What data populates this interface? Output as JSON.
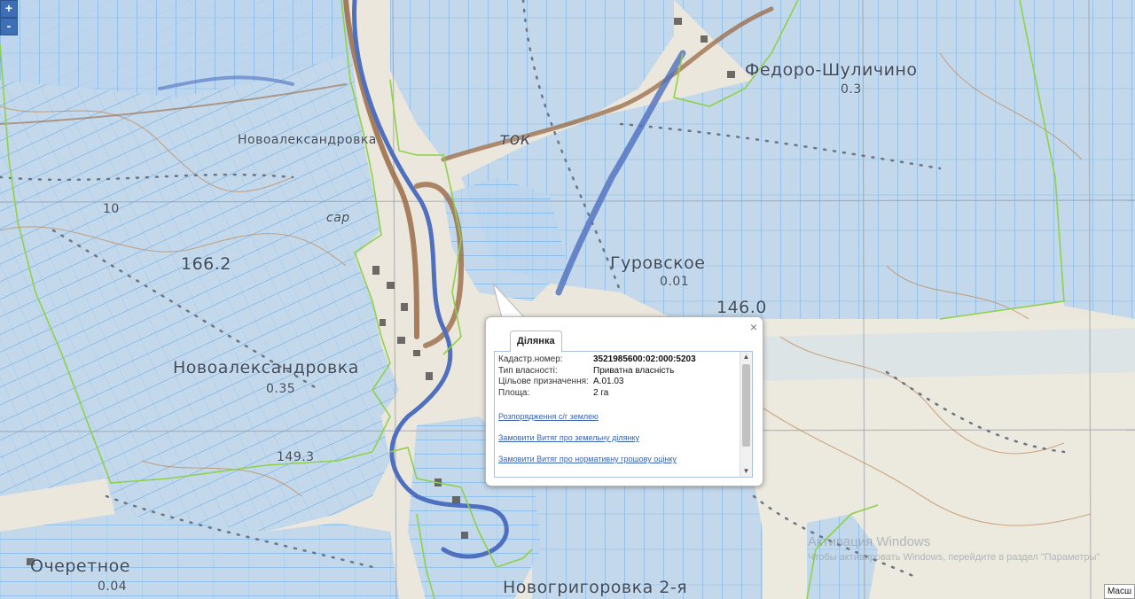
{
  "map": {
    "place_labels": [
      {
        "id": "fedoro-shulichino",
        "text": "Федоро-Шуличино"
      },
      {
        "id": "novaleksandrovka-top",
        "text": "Новоалександровка"
      },
      {
        "id": "novaleksandrovka-main",
        "text": "Новоалександровка"
      },
      {
        "id": "gurovskoe",
        "text": "Гуровское"
      },
      {
        "id": "ocheretnoe",
        "text": "Очеретное"
      },
      {
        "id": "novogrigorovka",
        "text": "Новогригоровка 2-я"
      },
      {
        "id": "tok",
        "text": "ток"
      },
      {
        "id": "sar",
        "text": "сар"
      },
      {
        "id": "elev-166",
        "text": "166.2"
      },
      {
        "id": "elev-146",
        "text": "146.0"
      },
      {
        "id": "elev-149",
        "text": "149.3"
      },
      {
        "id": "val-0-01",
        "text": "0.01"
      },
      {
        "id": "val-0-35",
        "text": "0.35"
      },
      {
        "id": "val-0-04",
        "text": "0.04"
      },
      {
        "id": "val-0-3",
        "text": "0.3"
      },
      {
        "id": "val-10",
        "text": "10"
      }
    ]
  },
  "controls": {
    "zoom_in": "+",
    "zoom_out": "-"
  },
  "popup": {
    "close": "×",
    "tab": "Ділянка",
    "fields": [
      {
        "key": "Кадастр.номер:",
        "value": "3521985600:02:000:5203"
      },
      {
        "key": "Тип власності:",
        "value": "Приватна власність"
      },
      {
        "key": "Цільове призначення:",
        "value": "A.01.03"
      },
      {
        "key": "Площа:",
        "value": "2 га"
      }
    ],
    "links": [
      "Розпорядження с/г землею",
      "Замовити Витяг про земельну ділянку",
      "Замовити Витяг про нормативну грошову оцінку"
    ],
    "scroll_up": "▲",
    "scroll_down": "▼"
  },
  "watermark": {
    "title": "Активация Windows",
    "subtitle": "Чтобы активировать Windows, перейдите в раздел \"Параметры\""
  },
  "scale": {
    "label": "Масш"
  },
  "colors": {
    "parcel_fill": "#b9d4ec",
    "parcel_line": "#5fa8e8",
    "boundary": "#8ed14a",
    "river": "#4f6fbf",
    "road": "#9a6b47"
  }
}
